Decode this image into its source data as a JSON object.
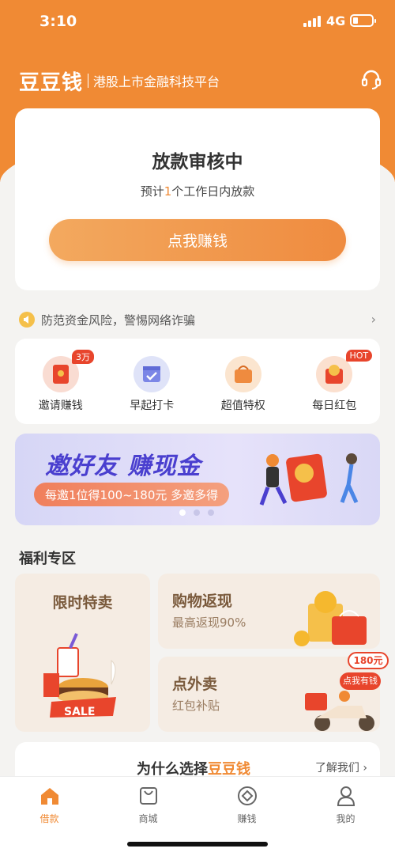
{
  "status": {
    "time": "3:10",
    "network": "4G"
  },
  "header": {
    "logo": "豆豆钱",
    "slogan": "港股上市金融科技平台",
    "support_icon": "headset-icon"
  },
  "loan_card": {
    "title": "放款审核中",
    "sub_prefix": "预计",
    "sub_num": "1",
    "sub_suffix": "个工作日内放款",
    "button": "点我赚钱"
  },
  "notice": {
    "text": "防范资金风险，警惕网络诈骗"
  },
  "quick": [
    {
      "label": "邀请赚钱",
      "badge": "3万",
      "icon": "red-envelope-icon"
    },
    {
      "label": "早起打卡",
      "badge": "",
      "icon": "calendar-check-icon"
    },
    {
      "label": "超值特权",
      "badge": "",
      "icon": "gift-bag-icon"
    },
    {
      "label": "每日红包",
      "badge": "HOT",
      "icon": "coin-envelope-icon"
    }
  ],
  "banner": {
    "title": "邀好友 赚现金",
    "subtitle": "每邀1位得100~180元 多邀多得"
  },
  "section_title": "福利专区",
  "welfare": {
    "flash": {
      "title": "限时特卖",
      "sale": "SALE"
    },
    "cashback": {
      "title": "购物返现",
      "sub": "最高返现90%"
    },
    "takeout": {
      "title": "点外卖",
      "sub": "红包补贴",
      "price": "180元",
      "tag": "点我有钱"
    }
  },
  "why": {
    "prefix": "为什么选择",
    "brand": "豆豆钱",
    "more": "了解我们"
  },
  "tabs": [
    {
      "label": "借款",
      "icon": "home-icon",
      "active": true
    },
    {
      "label": "商城",
      "icon": "shopping-bag-icon",
      "active": false
    },
    {
      "label": "赚钱",
      "icon": "earn-icon",
      "active": false
    },
    {
      "label": "我的",
      "icon": "profile-icon",
      "active": false
    }
  ],
  "colors": {
    "brand": "#f08a34",
    "background": "#f4f3f1",
    "banner_text": "#4a3fcf"
  }
}
